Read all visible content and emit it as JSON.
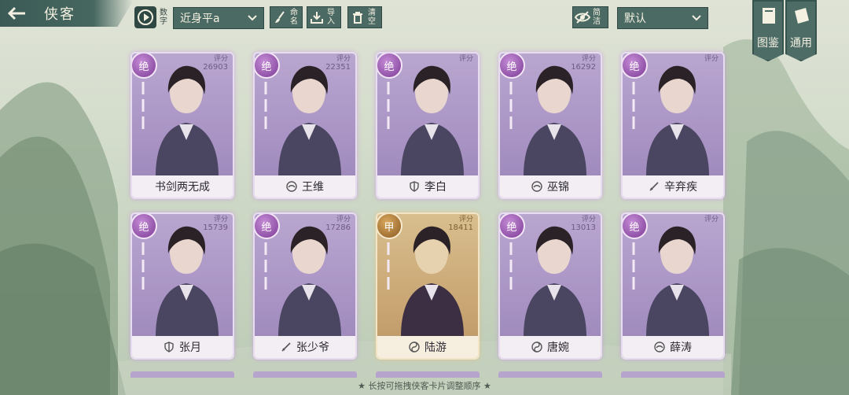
{
  "header": {
    "title": "侠客"
  },
  "toolbar": {
    "digits_label": "数字",
    "filter_value": "近身平a",
    "rename_label": "命名",
    "import_label": "导入",
    "clear_label": "清空",
    "simple_label": "简洁",
    "sort_value": "默认"
  },
  "side": {
    "atlas_label": "图鉴",
    "general_label": "通用"
  },
  "score_label": "评分",
  "cards": [
    {
      "name": "书剑两无成",
      "score": "26903",
      "badge": "绝",
      "icon": "none",
      "tier": "purple"
    },
    {
      "name": "王维",
      "score": "22351",
      "badge": "绝",
      "icon": "lotus-icon",
      "tier": "purple"
    },
    {
      "name": "李白",
      "score": "",
      "badge": "绝",
      "icon": "shield-icon",
      "tier": "purple"
    },
    {
      "name": "巫锦",
      "score": "16292",
      "badge": "绝",
      "icon": "lotus-icon",
      "tier": "purple"
    },
    {
      "name": "辛弃疾",
      "score": "",
      "badge": "绝",
      "icon": "sword-icon",
      "tier": "purple"
    },
    {
      "name": "张月",
      "score": "15739",
      "badge": "绝",
      "icon": "shield-icon",
      "tier": "purple"
    },
    {
      "name": "张少爷",
      "score": "17286",
      "badge": "绝",
      "icon": "sword-icon",
      "tier": "purple"
    },
    {
      "name": "陆游",
      "score": "18411",
      "badge": "甲",
      "icon": "taiji-icon",
      "tier": "gold"
    },
    {
      "name": "唐婉",
      "score": "13013",
      "badge": "绝",
      "icon": "taiji-icon",
      "tier": "purple"
    },
    {
      "name": "薛涛",
      "score": "",
      "badge": "绝",
      "icon": "lotus-icon",
      "tier": "purple"
    }
  ],
  "hint_text": "★ 长按可拖拽侠客卡片调整顺序 ★",
  "colors": {
    "bar": "#4c6a64",
    "card_purple": "#a893c4",
    "card_gold": "#caa775"
  }
}
